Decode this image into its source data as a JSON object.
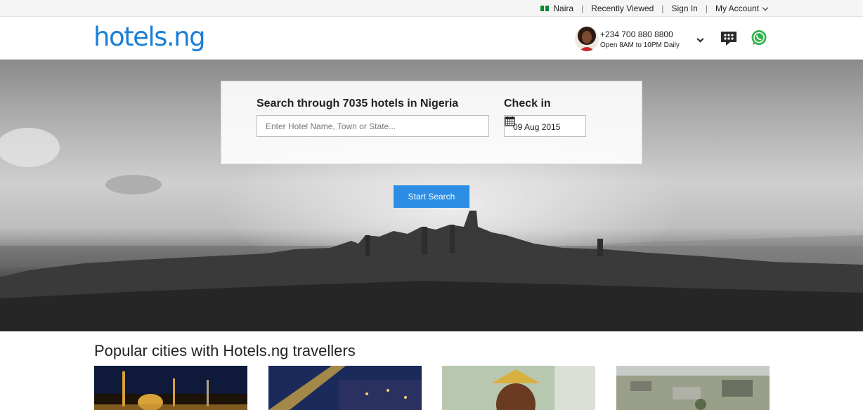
{
  "topbar": {
    "currency": "Naira",
    "links": [
      "Recently Viewed",
      "Sign In",
      "My Account"
    ]
  },
  "header": {
    "logo": "hotels.ng",
    "phone": "+234 700 880 8800",
    "hours": "Open 8AM to 10PM Daily"
  },
  "search": {
    "title": "Search through 7035 hotels in Nigeria",
    "placeholder": "Enter Hotel Name, Town or State...",
    "checkin_label": "Check in",
    "checkin_value": "09 Aug 2015",
    "button": "Start Search"
  },
  "popular": {
    "title": "Popular cities with Hotels.ng travellers"
  },
  "colors": {
    "brand": "#1a7fd6",
    "button": "#2b8de3",
    "flag_green": "#0a8a2e",
    "whatsapp": "#2fb24a"
  }
}
